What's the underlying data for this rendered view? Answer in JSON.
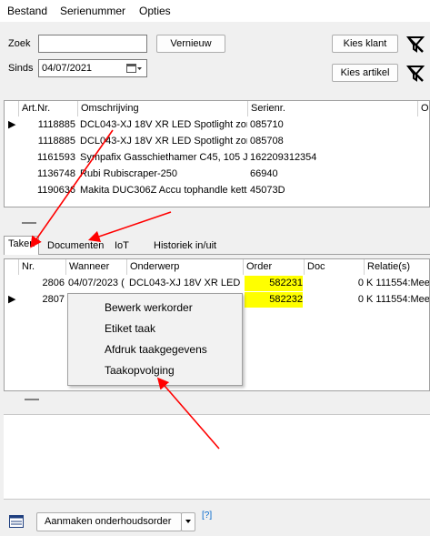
{
  "menu": [
    "Bestand",
    "Serienummer",
    "Opties"
  ],
  "search": {
    "label": "Zoek",
    "value": "",
    "refresh_label": "Vernieuw",
    "client_button": "Kies klant"
  },
  "since": {
    "label": "Sinds",
    "date": "04/07/2021",
    "article_button": "Kies artikel"
  },
  "serials_table": {
    "headers": [
      "Art.Nr.",
      "Omschrijving",
      "Serienr.",
      "O"
    ],
    "rows": [
      [
        "1118885",
        "DCL043-XJ 18V XR LED Spotlight zond",
        "085710"
      ],
      [
        "1118885",
        "DCL043-XJ 18V XR LED Spotlight zond",
        "085708"
      ],
      [
        "1161593",
        "Sympafix Gasschiethamer C45, 105 Jc",
        "162209312354"
      ],
      [
        "1136748",
        "Rubi Rubiscraper-250",
        "66940"
      ],
      [
        "1190636",
        "Makita DUC306Z Accu tophandle ketti",
        "45073D"
      ]
    ]
  },
  "tabs": [
    "Taken",
    "Documenten",
    "IoT",
    "Historiek in/uit"
  ],
  "tasks_table": {
    "headers": [
      "Nr.",
      "Wanneer",
      "Onderwerp",
      "Order",
      "Doc",
      "Relatie(s)"
    ],
    "rows": [
      [
        "2806",
        "04/07/2023 (",
        "DCL043-XJ 18V XR LED Sp",
        "582231",
        "0",
        "K 111554:Mee"
      ],
      [
        "2807",
        "",
        "",
        "582232",
        "0",
        "K 111554:Mee"
      ]
    ]
  },
  "context_menu": [
    "Bewerk werkorder",
    "Etiket taak",
    "Afdruk taakgegevens",
    "Taakopvolging"
  ],
  "footer": {
    "action_label": "Aanmaken onderhoudsorder",
    "help": "[?]"
  },
  "colors": {
    "highlight": "#ffff00",
    "arrow": "#ff0000",
    "selection": "#0078d7"
  }
}
